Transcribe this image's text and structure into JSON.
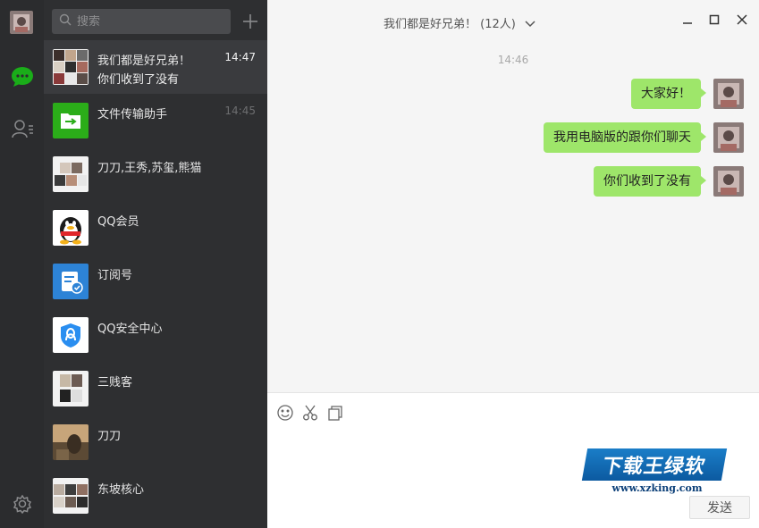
{
  "search": {
    "placeholder": "搜索"
  },
  "conversations": [
    {
      "name": "我们都是好兄弟！",
      "preview": "你们收到了没有",
      "time": "14:47",
      "active": true
    },
    {
      "name": "文件传输助手",
      "preview": "",
      "time": "14:45"
    },
    {
      "name": "刀刀,王秀,苏玺,熊猫",
      "preview": "",
      "time": ""
    },
    {
      "name": "QQ会员",
      "preview": "",
      "time": ""
    },
    {
      "name": "订阅号",
      "preview": "",
      "time": ""
    },
    {
      "name": "QQ安全中心",
      "preview": "",
      "time": ""
    },
    {
      "name": "三贱客",
      "preview": "",
      "time": ""
    },
    {
      "name": "刀刀",
      "preview": "",
      "time": ""
    },
    {
      "name": "东坡核心",
      "preview": "",
      "time": ""
    }
  ],
  "chat": {
    "title": "我们都是好兄弟！ (12人)",
    "timestamp": "14:46",
    "messages": [
      {
        "text": "大家好！"
      },
      {
        "text": "我用电脑版的跟你们聊天"
      },
      {
        "text": "你们收到了没有"
      }
    ]
  },
  "composer": {
    "send_label": "发送"
  },
  "watermark": {
    "brand": "下载王绿软",
    "url": "www.xzking.com"
  },
  "colors": {
    "rail": "#2b2c2e",
    "list": "#2e2f31",
    "active_item": "#3a3b3e",
    "bubble": "#9ee66a",
    "accent_green": "#1aad19",
    "file_helper_bg": "#2bad19",
    "subscription_bg": "#2d83d6",
    "security_bg": "#ffffff"
  },
  "icons": {
    "rail": [
      "chat-icon",
      "contacts-icon",
      "settings-icon"
    ],
    "toolbar": [
      "emoji-icon",
      "scissors-icon",
      "file-icon"
    ],
    "window": [
      "minimize-icon",
      "maximize-icon",
      "close-icon"
    ]
  }
}
